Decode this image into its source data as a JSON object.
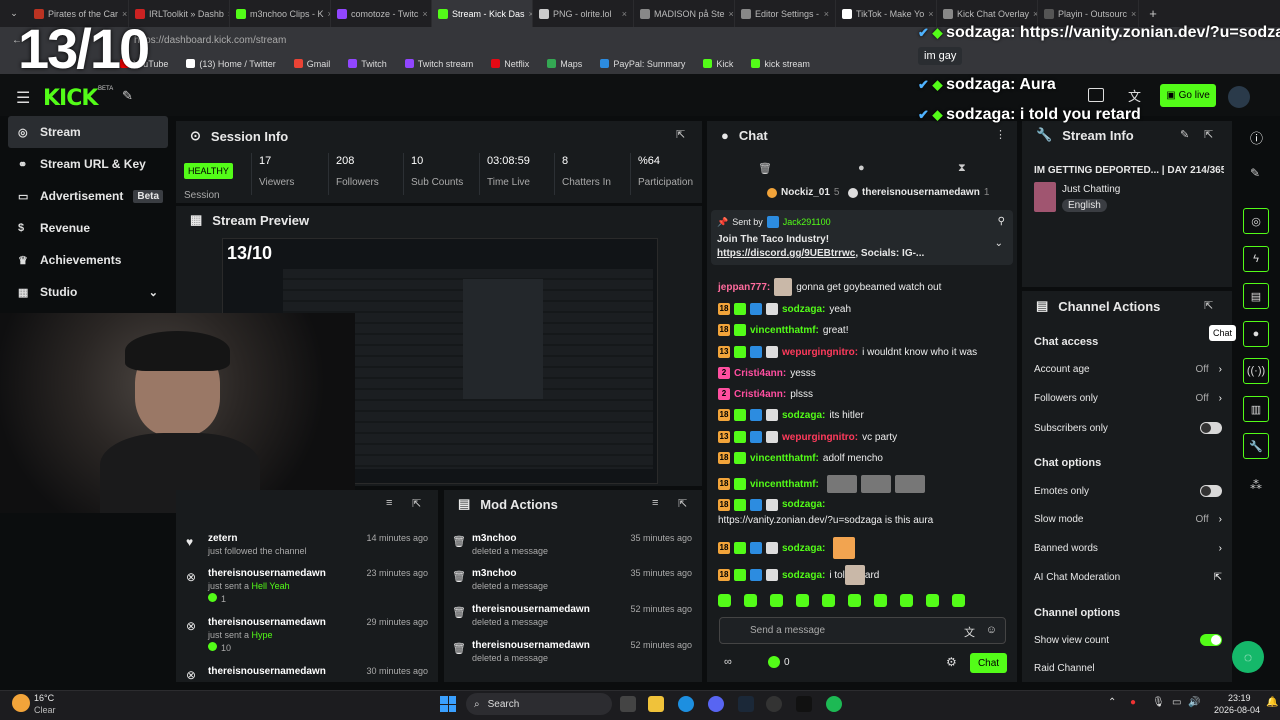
{
  "browser": {
    "tabs": [
      {
        "label": "Pirates of the Car",
        "color": "#b32"
      },
      {
        "label": "IRLToolkit » Dashb",
        "color": "#c22"
      },
      {
        "label": "m3nchoo Clips - K",
        "color": "#53fc18"
      },
      {
        "label": "comotoze - Twitc",
        "color": "#9146ff"
      },
      {
        "label": "Stream - Kick Das",
        "color": "#53fc18"
      },
      {
        "label": "PNG - olrite.lol",
        "color": "#ccc"
      },
      {
        "label": "MADISON på Ste",
        "color": "#888"
      },
      {
        "label": "Editor Settings -",
        "color": "#888"
      },
      {
        "label": "TikTok - Make Yo",
        "color": "#fff"
      },
      {
        "label": "Kick Chat Overlay",
        "color": "#888"
      },
      {
        "label": "Playin - Outsourc",
        "color": "#555"
      }
    ],
    "url": "https://dashboard.kick.com/stream",
    "bookmarks": [
      {
        "label": "YouTube",
        "color": "#f00"
      },
      {
        "label": "(13) Home / Twitter",
        "color": "#fff"
      },
      {
        "label": "Gmail",
        "color": "#ea4335"
      },
      {
        "label": "Twitch",
        "color": "#9146ff"
      },
      {
        "label": "Twitch stream",
        "color": "#9146ff"
      },
      {
        "label": "Netflix",
        "color": "#e50914"
      },
      {
        "label": "Maps",
        "color": "#34a853"
      },
      {
        "label": "PayPal: Summary",
        "color": "#2c8ce0"
      },
      {
        "label": "Kick",
        "color": "#53fc18"
      },
      {
        "label": "kick stream",
        "color": "#53fc18"
      }
    ]
  },
  "overlay": {
    "rating": "13/10",
    "chat": [
      {
        "user": "sodzaga:",
        "text": "https://vanity.zonian.dev/?u=sodzaga"
      },
      {
        "user": "sodzaga:",
        "text": "Aura"
      },
      {
        "user": "sodzaga:",
        "text": "i told you retard"
      }
    ],
    "tooltip": "im gay"
  },
  "logo": "KICK",
  "logo_beta": "BETA",
  "go_live": "Go live",
  "sidebar": {
    "items": [
      {
        "label": "Stream",
        "icon": "stream-icon"
      },
      {
        "label": "Stream URL & Key",
        "icon": "link-icon"
      },
      {
        "label": "Advertisement",
        "icon": "ad-icon",
        "badge": "Beta"
      },
      {
        "label": "Revenue",
        "icon": "revenue-icon"
      },
      {
        "label": "Achievements",
        "icon": "trophy-icon"
      },
      {
        "label": "Studio",
        "icon": "studio-icon"
      }
    ]
  },
  "session": {
    "title": "Session Info",
    "status": "HEALTHY",
    "status_label": "Session",
    "stats": [
      {
        "v": "17",
        "l": "Viewers"
      },
      {
        "v": "208",
        "l": "Followers"
      },
      {
        "v": "10",
        "l": "Sub Counts"
      },
      {
        "v": "03:08:59",
        "l": "Time Live"
      },
      {
        "v": "8",
        "l": "Chatters In"
      },
      {
        "v": "%64",
        "l": "Participation"
      }
    ]
  },
  "preview": {
    "title": "Stream Preview",
    "rating": "13/10"
  },
  "activity": [
    {
      "user": "zetern",
      "action": "just followed the channel",
      "time": "14 minutes ago"
    },
    {
      "user": "thereisnousernamedawn",
      "action": "just sent a",
      "item": "Hell Yeah",
      "count": "1",
      "time": "23 minutes ago"
    },
    {
      "user": "thereisnousernamedawn",
      "action": "just sent a",
      "item": "Hype",
      "count": "10",
      "time": "29 minutes ago"
    },
    {
      "user": "thereisnousernamedawn",
      "action": "",
      "time": "30 minutes ago"
    }
  ],
  "mod": {
    "title": "Mod Actions",
    "items": [
      {
        "user": "m3nchoo",
        "action": "deleted a message",
        "time": "35 minutes ago"
      },
      {
        "user": "m3nchoo",
        "action": "deleted a message",
        "time": "35 minutes ago"
      },
      {
        "user": "thereisnousernamedawn",
        "action": "deleted a message",
        "time": "52 minutes ago"
      },
      {
        "user": "thereisnousernamedawn",
        "action": "deleted a message",
        "time": "52 minutes ago"
      }
    ]
  },
  "chat": {
    "title": "Chat",
    "top": [
      {
        "name": "Nockiz_01",
        "n": "5"
      },
      {
        "name": "thereisnousernamedawn",
        "n": "1"
      }
    ],
    "pinned": {
      "by": "Sent by",
      "user": "Jack291100",
      "text": "Join The Taco Industry!",
      "link": "https://discord.gg/9UEBtrrwc",
      "rest": ", Socials: IG-..."
    },
    "messages": [
      {
        "badge": "",
        "user": "jeppan777:",
        "color": "#ff6b9d",
        "text": "gonna get goybeamed watch out"
      },
      {
        "badge": "18",
        "user": "sodzaga:",
        "color": "#53fc18",
        "text": "yeah"
      },
      {
        "badge": "18",
        "user": "vincentthatmf:",
        "color": "#53fc18",
        "text": "great!"
      },
      {
        "badge": "13",
        "user": "wepurgingnitro:",
        "color": "#ff3b5c",
        "text": "i wouldnt know who it was"
      },
      {
        "badge": "2m",
        "user": "Cristi4ann:",
        "color": "#ff4fa0",
        "text": "yesss"
      },
      {
        "badge": "2m",
        "user": "Cristi4ann:",
        "color": "#ff4fa0",
        "text": "plsss"
      },
      {
        "badge": "18",
        "user": "sodzaga:",
        "color": "#53fc18",
        "text": "its hitler"
      },
      {
        "badge": "13",
        "user": "wepurgingnitro:",
        "color": "#ff3b5c",
        "text": "vc party"
      },
      {
        "badge": "18",
        "user": "vincentthatmf:",
        "color": "#53fc18",
        "text": "adolf mencho"
      },
      {
        "badge": "18",
        "user": "vincentthatmf:",
        "color": "#53fc18",
        "text": ""
      },
      {
        "badge": "18",
        "user": "sodzaga:",
        "color": "#53fc18",
        "text": "https://vanity.zonian.dev/?u=sodzaga is this aura"
      },
      {
        "badge": "18",
        "user": "sodzaga:",
        "color": "#53fc18",
        "text": ""
      },
      {
        "badge": "18",
        "user": "sodzaga:",
        "color": "#53fc18",
        "text": "i told    retard"
      }
    ],
    "placeholder": "Send a message",
    "count": "0",
    "send": "Chat"
  },
  "streaminfo": {
    "title": "Stream Info",
    "stream_title": "IM GETTING DEPORTED... | DAY 214/365",
    "category": "Just Chatting",
    "tag": "English"
  },
  "actions": {
    "title": "Channel Actions",
    "chat_access": "Chat access",
    "rows1": [
      {
        "label": "Account age",
        "value": "Off",
        "kind": "arrow"
      },
      {
        "label": "Followers only",
        "value": "Off",
        "kind": "arrow"
      },
      {
        "label": "Subscribers only",
        "value": "",
        "kind": "toggle",
        "on": false
      }
    ],
    "chat_options": "Chat options",
    "rows2": [
      {
        "label": "Emotes only",
        "value": "",
        "kind": "toggle",
        "on": false
      },
      {
        "label": "Slow mode",
        "value": "Off",
        "kind": "arrow"
      },
      {
        "label": "Banned words",
        "value": "",
        "kind": "arrow"
      },
      {
        "label": "AI Chat Moderation",
        "value": "",
        "kind": "ext"
      }
    ],
    "channel_options": "Channel options",
    "rows3": [
      {
        "label": "Show view count",
        "value": "",
        "kind": "toggle",
        "on": true
      },
      {
        "label": "Raid Channel",
        "value": "",
        "kind": "none"
      }
    ]
  },
  "rail_tooltip": "Chat",
  "taskbar": {
    "weather_temp": "16°C",
    "weather_desc": "Clear",
    "search": "Search",
    "time": "23:19",
    "date": "2026-08-04"
  }
}
